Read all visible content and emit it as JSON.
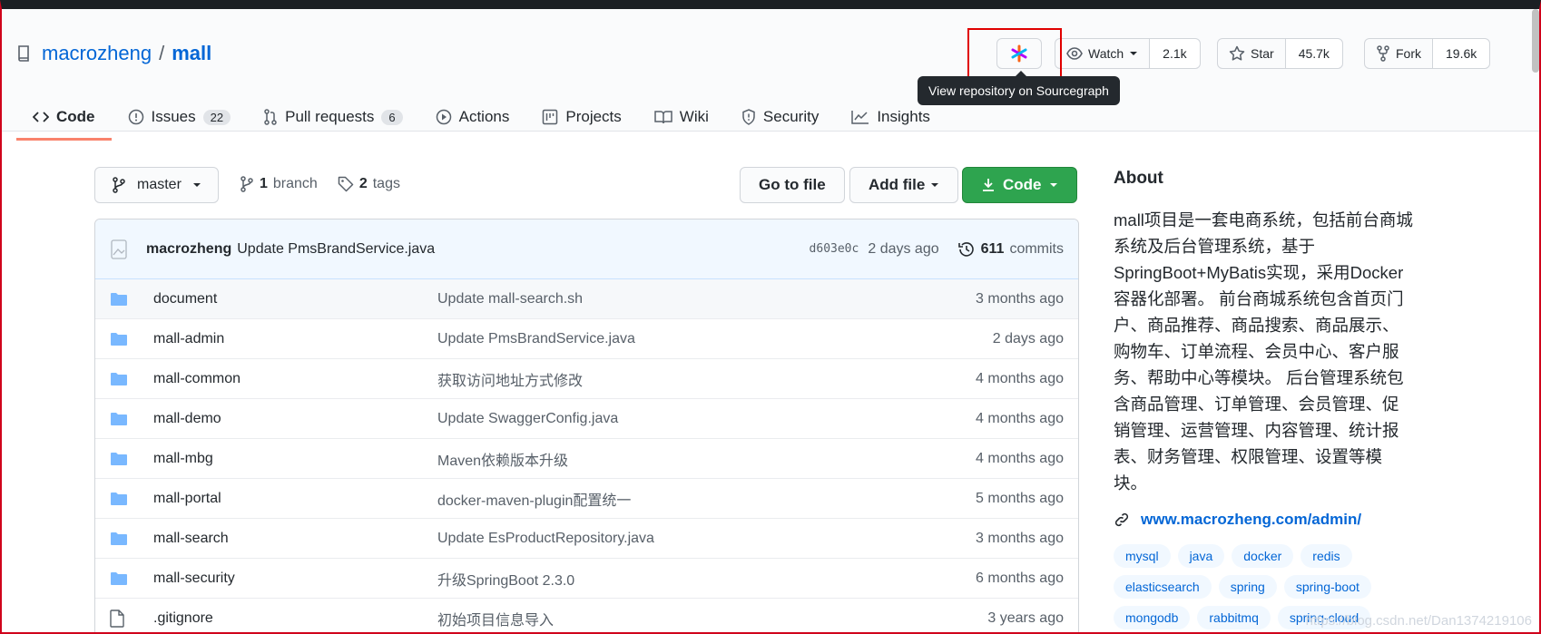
{
  "repo": {
    "owner": "macrozheng",
    "separator": "/",
    "name": "mall"
  },
  "sourcegraph": {
    "tooltip": "View repository on Sourcegraph"
  },
  "actions": {
    "watch": {
      "label": "Watch",
      "count": "2.1k"
    },
    "star": {
      "label": "Star",
      "count": "45.7k"
    },
    "fork": {
      "label": "Fork",
      "count": "19.6k"
    }
  },
  "tabs": [
    {
      "label": "Code",
      "icon": "code-icon",
      "active": true
    },
    {
      "label": "Issues",
      "count": "22",
      "icon": "issue-icon"
    },
    {
      "label": "Pull requests",
      "count": "6",
      "icon": "pull-request-icon"
    },
    {
      "label": "Actions",
      "icon": "play-icon"
    },
    {
      "label": "Projects",
      "icon": "project-icon"
    },
    {
      "label": "Wiki",
      "icon": "book-icon"
    },
    {
      "label": "Security",
      "icon": "shield-icon"
    },
    {
      "label": "Insights",
      "icon": "graph-icon"
    }
  ],
  "toolbar": {
    "branch": "master",
    "branch_count": "1",
    "branch_label": "branch",
    "tag_count": "2",
    "tag_label": "tags",
    "goto_file": "Go to file",
    "add_file": "Add file",
    "code": "Code"
  },
  "commit": {
    "author": "macrozheng",
    "message": "Update PmsBrandService.java",
    "sha": "d603e0c",
    "age": "2 days ago",
    "count": "611",
    "count_label": "commits"
  },
  "files": [
    {
      "type": "folder",
      "name": "document",
      "message": "Update mall-search.sh",
      "age": "3 months ago"
    },
    {
      "type": "folder",
      "name": "mall-admin",
      "message": "Update PmsBrandService.java",
      "age": "2 days ago"
    },
    {
      "type": "folder",
      "name": "mall-common",
      "message": "获取访问地址方式修改",
      "age": "4 months ago"
    },
    {
      "type": "folder",
      "name": "mall-demo",
      "message": "Update SwaggerConfig.java",
      "age": "4 months ago"
    },
    {
      "type": "folder",
      "name": "mall-mbg",
      "message": "Maven依赖版本升级",
      "age": "4 months ago"
    },
    {
      "type": "folder",
      "name": "mall-portal",
      "message": "docker-maven-plugin配置统一",
      "age": "5 months ago"
    },
    {
      "type": "folder",
      "name": "mall-search",
      "message": "Update EsProductRepository.java",
      "age": "3 months ago"
    },
    {
      "type": "folder",
      "name": "mall-security",
      "message": "升级SpringBoot 2.3.0",
      "age": "6 months ago"
    },
    {
      "type": "file",
      "name": ".gitignore",
      "message": "初始项目信息导入",
      "age": "3 years ago"
    }
  ],
  "about": {
    "title": "About",
    "description": "mall项目是一套电商系统，包括前台商城系统及后台管理系统，基于SpringBoot+MyBatis实现，采用Docker容器化部署。 前台商城系统包含首页门户、商品推荐、商品搜索、商品展示、购物车、订单流程、会员中心、客户服务、帮助中心等模块。 后台管理系统包含商品管理、订单管理、会员管理、促销管理、运营管理、内容管理、统计报表、财务管理、权限管理、设置等模块。",
    "link": "www.macrozheng.com/admin/",
    "topics": [
      "mysql",
      "java",
      "docker",
      "redis",
      "elasticsearch",
      "spring",
      "spring-boot",
      "mongodb",
      "rabbitmq",
      "spring-cloud"
    ]
  },
  "watermark": "https://blog.csdn.net/Dan1374219106",
  "colors": {
    "accent": "#0366d6",
    "primary_button": "#2ea44f",
    "tab_underline": "#f9826c",
    "highlight": "#e00000"
  }
}
